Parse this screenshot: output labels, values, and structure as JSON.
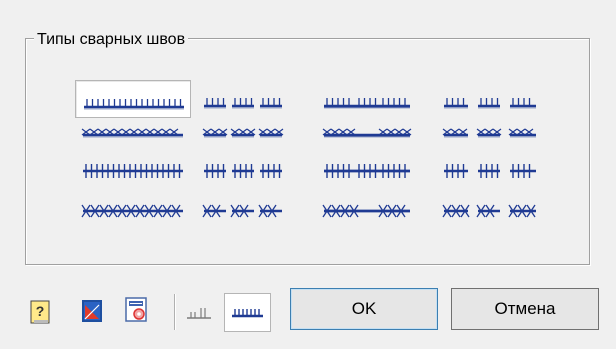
{
  "group": {
    "title": "Типы сварных швов"
  },
  "weld_types": [
    {
      "icon": "continuous-weld-ticks-icon",
      "selected": true
    },
    {
      "icon": "intermittent-weld-ticks-icon",
      "selected": false
    },
    {
      "icon": "chain-weld-ticks-icon",
      "selected": false
    },
    {
      "icon": "staggered-weld-ticks-icon",
      "selected": false
    },
    {
      "icon": "continuous-weld-cross-icon",
      "selected": false
    },
    {
      "icon": "intermittent-weld-cross-icon",
      "selected": false
    },
    {
      "icon": "chain-weld-cross-icon",
      "selected": false
    },
    {
      "icon": "staggered-weld-cross-icon",
      "selected": false
    },
    {
      "icon": "continuous-weld-hash-icon",
      "selected": false
    },
    {
      "icon": "intermittent-weld-hash-icon",
      "selected": false
    },
    {
      "icon": "chain-weld-hash-icon",
      "selected": false
    },
    {
      "icon": "staggered-weld-hash-icon",
      "selected": false
    },
    {
      "icon": "continuous-weld-xcross-icon",
      "selected": false
    },
    {
      "icon": "intermittent-weld-xcross-icon",
      "selected": false
    },
    {
      "icon": "chain-weld-xcross-icon",
      "selected": false
    },
    {
      "icon": "staggered-weld-xcross-icon",
      "selected": false
    }
  ],
  "toolbar": {
    "help_icon": "help-icon",
    "drawing_icon": "drawing-icon",
    "settings_icon": "stamp-settings-icon",
    "weld_mode_a_icon": "weld-mode-ticks-icon",
    "weld_mode_b_icon": "weld-mode-active-icon"
  },
  "buttons": {
    "ok_label": "OK",
    "cancel_label": "Отмена"
  },
  "colors": {
    "weld_line": "#1f3a93",
    "weld_shadow": "#9aa6c8",
    "help_yellow": "#ffe98a"
  }
}
